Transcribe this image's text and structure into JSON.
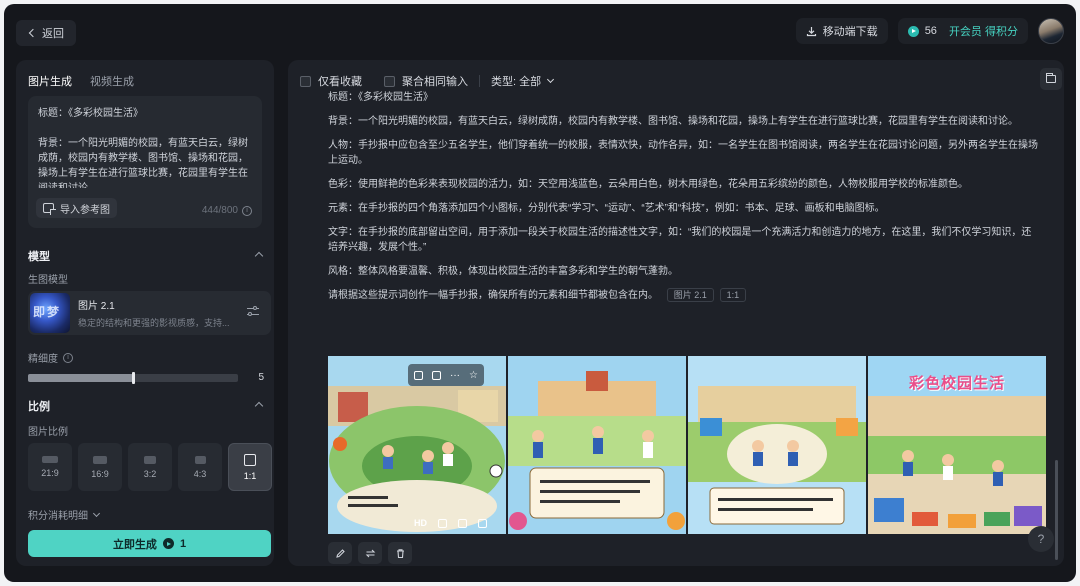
{
  "header": {
    "back_label": "返回",
    "download_label": "移动端下载",
    "points": "56",
    "vip_label": "开会员 得积分"
  },
  "left": {
    "tabs": [
      "图片生成",
      "视频生成"
    ],
    "prompt": "标题：《多彩校园生活》\n\n背景：一个阳光明媚的校园，有蓝天白云，绿树成荫，校园内有教学楼、图书馆、操场和花园，操场上有学生在进行篮球比赛，花园里有学生在阅读和讨论。",
    "ref_button": "导入参考图",
    "char_count": "444/800",
    "model_section": "模型",
    "model_label": "生图模型",
    "model_name": "图片 2.1",
    "model_desc": "稳定的结构和更强的影视质感，支持...",
    "model_thumb_text": "即梦",
    "detail_label": "精细度",
    "detail_value": "5",
    "detail_fraction": 0.5,
    "ratio_section": "比例",
    "ratio_label": "图片比例",
    "ratios": [
      "21:9",
      "16:9",
      "3:2",
      "4:3",
      "1:1"
    ],
    "ratio_selected": "1:1",
    "points_detail": "积分消耗明细",
    "generate_label": "立即生成",
    "generate_cost": "1"
  },
  "right": {
    "filters": {
      "favorites": "仅看收藏",
      "merge": "聚合相同输入",
      "type": "类型: 全部"
    },
    "paragraphs": [
      "标题：《多彩校园生活》",
      "背景：一个阳光明媚的校园，有蓝天白云，绿树成荫，校园内有教学楼、图书馆、操场和花园，操场上有学生在进行篮球比赛，花园里有学生在阅读和讨论。",
      "人物：手抄报中应包含至少五名学生，他们穿着统一的校服，表情欢快，动作各异，如：一名学生在图书馆阅读，两名学生在花园讨论问题，另外两名学生在操场上运动。",
      "色彩：使用鲜艳的色彩来表现校园的活力，如：天空用浅蓝色，云朵用白色，树木用绿色，花朵用五彩缤纷的颜色，人物校服用学校的标准颜色。",
      "元素：在手抄报的四个角落添加四个小图标，分别代表“学习”、“运动”、“艺术”和“科技”，例如：书本、足球、画板和电脑图标。",
      "文字：在手抄报的底部留出空间，用于添加一段关于校园生活的描述性文字，如：“我们的校园是一个充满活力和创造力的地方，在这里，我们不仅学习知识，还培养兴趣，发展个性。”",
      "风格：整体风格要温馨、积极，体现出校园生活的丰富多彩和学生的朝气蓬勃。"
    ],
    "last_line": "请根据这些提示词创作一幅手抄报，确保所有的元素和细节都被包含在内。",
    "tags": [
      "图片 2.1",
      "1:1"
    ],
    "image_overlay_label": "HD",
    "image4_title": "彩色校园生活",
    "help_label": "?"
  }
}
